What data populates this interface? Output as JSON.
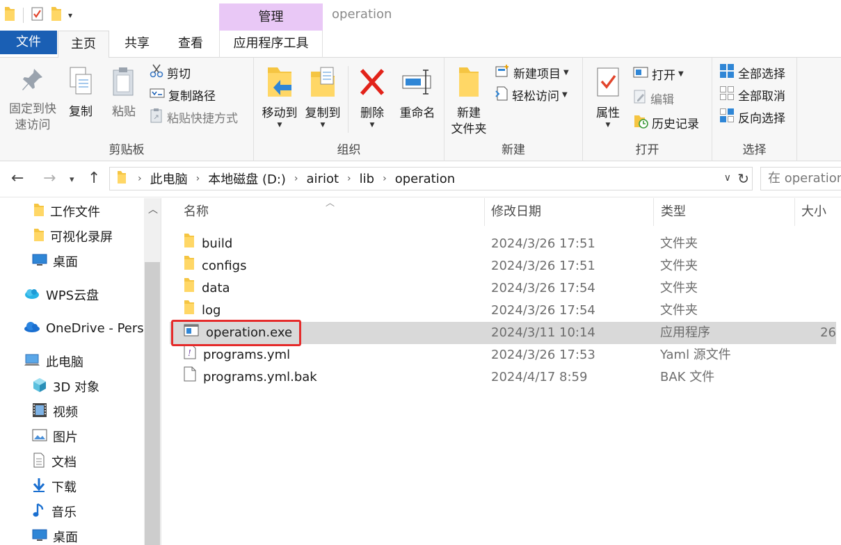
{
  "window": {
    "title": "operation",
    "contextual_tab_group": "管理"
  },
  "ribbon_tabs": {
    "file": "文件",
    "home": "主页",
    "share": "共享",
    "view": "查看",
    "app_tools": "应用程序工具"
  },
  "ribbon": {
    "clipboard": {
      "label": "剪贴板",
      "pin_line1": "固定到快",
      "pin_line2": "速访问",
      "copy": "复制",
      "paste": "粘贴",
      "cut": "剪切",
      "copy_path": "复制路径",
      "paste_shortcut": "粘贴快捷方式"
    },
    "organize": {
      "label": "组织",
      "move_to": "移动到",
      "copy_to": "复制到",
      "delete": "删除",
      "rename": "重命名"
    },
    "new": {
      "label": "新建",
      "new_folder_line1": "新建",
      "new_folder_line2": "文件夹",
      "new_item": "新建项目",
      "easy_access": "轻松访问"
    },
    "open": {
      "label": "打开",
      "properties": "属性",
      "open": "打开",
      "edit": "编辑",
      "history": "历史记录"
    },
    "select": {
      "label": "选择",
      "select_all": "全部选择",
      "select_none": "全部取消",
      "invert": "反向选择"
    }
  },
  "address": {
    "crumbs": [
      "此电脑",
      "本地磁盘 (D:)",
      "airiot",
      "lib",
      "operation"
    ],
    "search_placeholder": "在 operation"
  },
  "nav_pane": {
    "items": [
      {
        "label": "工作文件",
        "icon": "folder-icon"
      },
      {
        "label": "可视化录屏",
        "icon": "folder-icon"
      },
      {
        "label": "桌面",
        "icon": "desktop-icon"
      },
      {
        "label": "WPS云盘",
        "icon": "cloud-icon"
      },
      {
        "label": "OneDrive - Persc",
        "icon": "onedrive-icon"
      },
      {
        "label": "此电脑",
        "icon": "computer-icon"
      },
      {
        "label": "3D 对象",
        "icon": "3d-objects-icon"
      },
      {
        "label": "视频",
        "icon": "video-icon"
      },
      {
        "label": "图片",
        "icon": "pictures-icon"
      },
      {
        "label": "文档",
        "icon": "documents-icon"
      },
      {
        "label": "下载",
        "icon": "download-icon"
      },
      {
        "label": "音乐",
        "icon": "music-icon"
      },
      {
        "label": "桌面",
        "icon": "desktop-icon"
      }
    ]
  },
  "file_list": {
    "columns": {
      "name": "名称",
      "date": "修改日期",
      "type": "类型",
      "size": "大小"
    },
    "rows": [
      {
        "name": "build",
        "date": "2024/3/26 17:51",
        "type": "文件夹",
        "size": "",
        "icon": "folder-icon"
      },
      {
        "name": "configs",
        "date": "2024/3/26 17:51",
        "type": "文件夹",
        "size": "",
        "icon": "folder-icon"
      },
      {
        "name": "data",
        "date": "2024/3/26 17:54",
        "type": "文件夹",
        "size": "",
        "icon": "folder-icon"
      },
      {
        "name": "log",
        "date": "2024/3/26 17:54",
        "type": "文件夹",
        "size": "",
        "icon": "folder-icon"
      },
      {
        "name": "operation.exe",
        "date": "2024/3/11 10:14",
        "type": "应用程序",
        "size": "26",
        "icon": "exe-icon"
      },
      {
        "name": "programs.yml",
        "date": "2024/3/26 17:53",
        "type": "Yaml 源文件",
        "size": "",
        "icon": "yaml-file-icon"
      },
      {
        "name": "programs.yml.bak",
        "date": "2024/4/17 8:59",
        "type": "BAK 文件",
        "size": "",
        "icon": "file-icon"
      }
    ]
  },
  "colors": {
    "file_tab": "#1a5fb4",
    "manage_tab": "#e9c8f6",
    "selection": "#d9d9d9",
    "highlight": "#e52b2b",
    "folder": "#f5c542"
  }
}
